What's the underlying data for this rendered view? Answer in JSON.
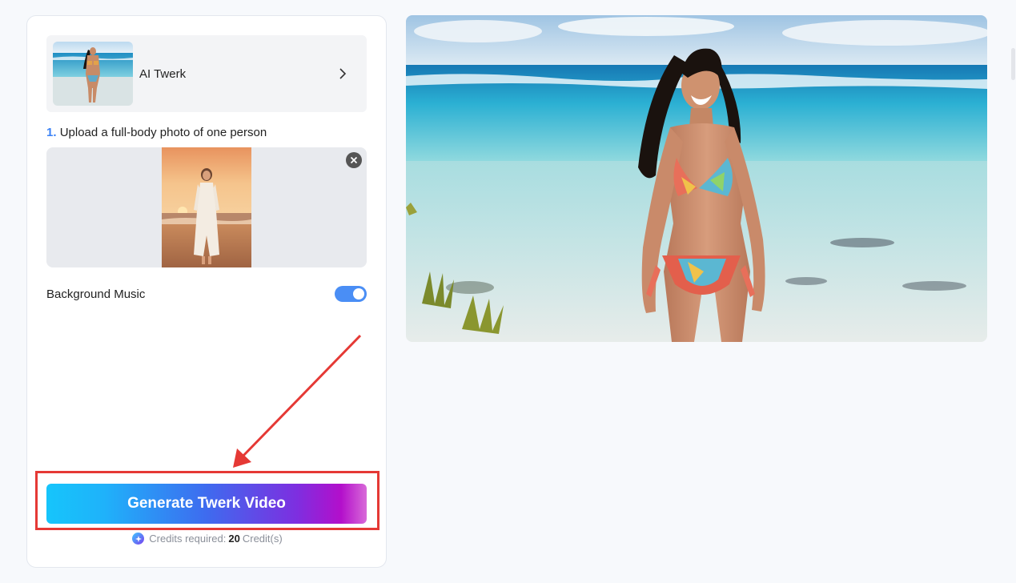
{
  "tool": {
    "name": "AI Twerk",
    "thumb_icon": "beach-woman-thumbnail"
  },
  "upload": {
    "step_number": "1.",
    "step_text": "Upload a full-body photo of one person"
  },
  "music": {
    "label": "Background Music",
    "enabled": true
  },
  "generate": {
    "label": "Generate Twerk Video"
  },
  "credits": {
    "prefix": "Credits required:",
    "value": "20",
    "suffix": "Credit(s)"
  },
  "colors": {
    "accent": "#3b82f6",
    "toggle": "#4a8ef5",
    "highlight": "#e53935",
    "gradient_start": "#16c5fb",
    "gradient_end": "#b30fcb"
  }
}
